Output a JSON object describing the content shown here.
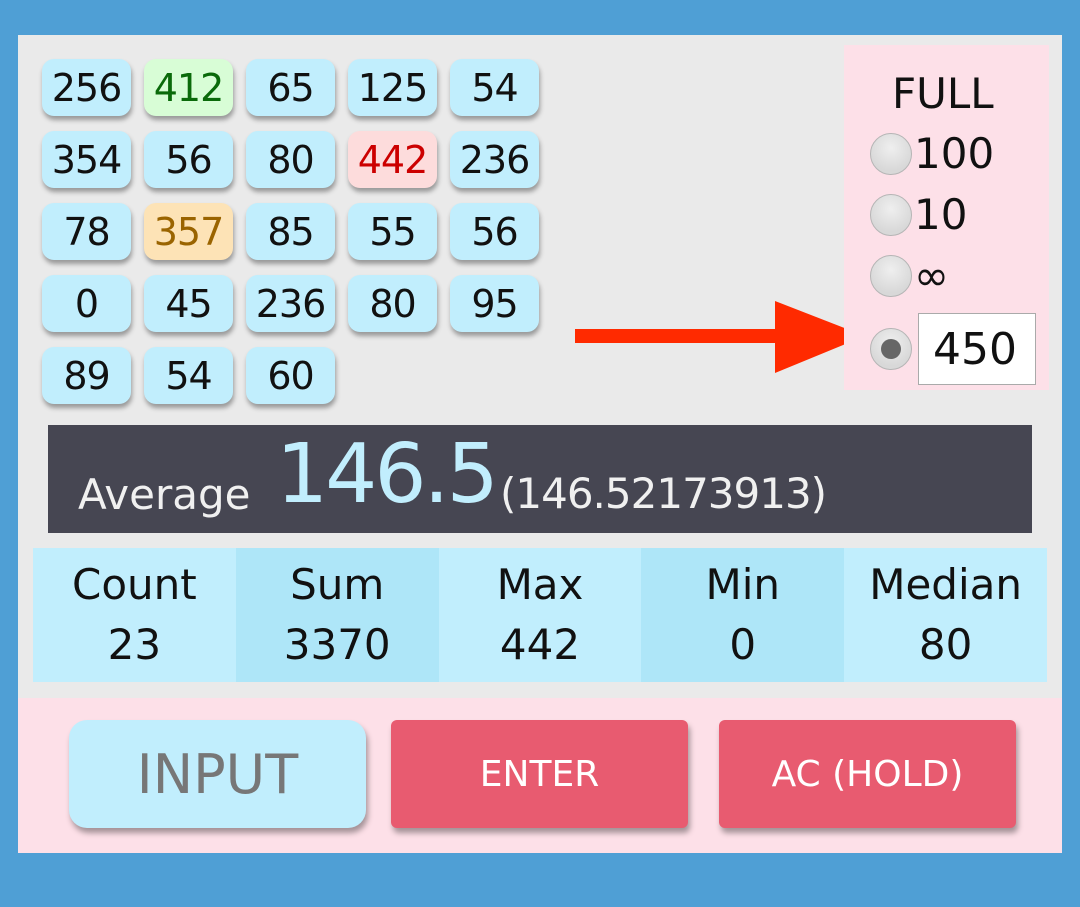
{
  "values_grid": [
    {
      "value": "256",
      "highlight": "none"
    },
    {
      "value": "412",
      "highlight": "green"
    },
    {
      "value": "65",
      "highlight": "none"
    },
    {
      "value": "125",
      "highlight": "none"
    },
    {
      "value": "54",
      "highlight": "none"
    },
    {
      "value": "354",
      "highlight": "none"
    },
    {
      "value": "56",
      "highlight": "none"
    },
    {
      "value": "80",
      "highlight": "none"
    },
    {
      "value": "442",
      "highlight": "red"
    },
    {
      "value": "236",
      "highlight": "none"
    },
    {
      "value": "78",
      "highlight": "none"
    },
    {
      "value": "357",
      "highlight": "orange"
    },
    {
      "value": "85",
      "highlight": "none"
    },
    {
      "value": "55",
      "highlight": "none"
    },
    {
      "value": "56",
      "highlight": "none"
    },
    {
      "value": "0",
      "highlight": "none"
    },
    {
      "value": "45",
      "highlight": "none"
    },
    {
      "value": "236",
      "highlight": "none"
    },
    {
      "value": "80",
      "highlight": "none"
    },
    {
      "value": "95",
      "highlight": "none"
    },
    {
      "value": "89",
      "highlight": "none"
    },
    {
      "value": "54",
      "highlight": "none"
    },
    {
      "value": "60",
      "highlight": "none"
    }
  ],
  "full_panel": {
    "title": "FULL",
    "options": [
      {
        "label": "100",
        "selected": false
      },
      {
        "label": "10",
        "selected": false
      },
      {
        "label": "∞",
        "selected": false
      },
      {
        "label": "",
        "selected": true
      }
    ],
    "custom_value": "450"
  },
  "average": {
    "label": "Average",
    "value": "146.5",
    "full_value": "(146.52173913)"
  },
  "stats": [
    {
      "label": "Count",
      "value": "23"
    },
    {
      "label": "Sum",
      "value": "3370"
    },
    {
      "label": "Max",
      "value": "442"
    },
    {
      "label": "Min",
      "value": "0"
    },
    {
      "label": "Median",
      "value": "80"
    }
  ],
  "buttons": {
    "input": "INPUT",
    "enter": "ENTER",
    "ac": "AC (HOLD)"
  },
  "colors": {
    "background": "#4f9fd5",
    "cell": "#c1eefd",
    "max_highlight": "#fddcdc",
    "green_highlight": "#d8fdd6",
    "orange_highlight": "#fde3b6",
    "action_button": "#e85b70",
    "arrow": "#ff2a00"
  }
}
